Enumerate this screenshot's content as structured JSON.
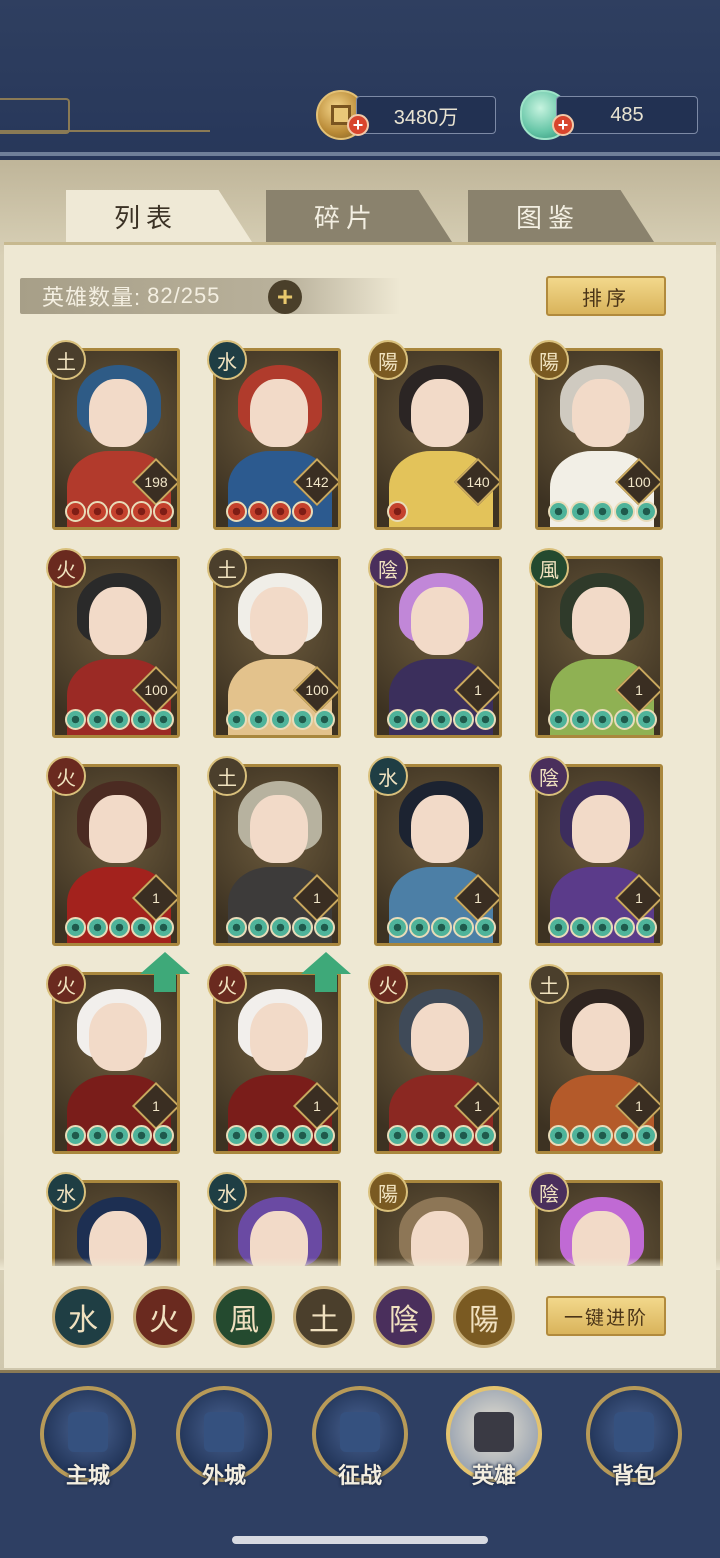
{
  "header": {
    "coin_value": "3480万",
    "gem_value": "485",
    "colors": {
      "bar": "#2b3a5a",
      "accent_gold": "#d9b45b"
    }
  },
  "tabs": [
    {
      "label": "列表",
      "active": true
    },
    {
      "label": "碎片",
      "active": false
    },
    {
      "label": "图鉴",
      "active": false
    }
  ],
  "hero_count": {
    "label": "英雄数量:",
    "value": "82/255"
  },
  "sort_label": "排序",
  "advance_label": "一键进阶",
  "heroes": [
    {
      "element": "土",
      "level": "198",
      "stars": 5,
      "star_color": "red",
      "hair": "#2e5b86",
      "outfit": "#b23a2c"
    },
    {
      "element": "水",
      "level": "142",
      "stars": 4,
      "star_color": "red",
      "hair": "#b03b2c",
      "outfit": "#2c5a8f"
    },
    {
      "element": "陽",
      "level": "140",
      "stars": 1,
      "star_color": "red",
      "hair": "#2b2524",
      "outfit": "#e3c35a"
    },
    {
      "element": "陽",
      "level": "100",
      "stars": 5,
      "star_color": "green",
      "hair": "#cfcac0",
      "outfit": "#f2efe6"
    },
    {
      "element": "火",
      "level": "100",
      "stars": 5,
      "star_color": "green",
      "hair": "#2a2a2a",
      "outfit": "#9b2a25"
    },
    {
      "element": "土",
      "level": "100",
      "stars": 5,
      "star_color": "green",
      "hair": "#f0eee8",
      "outfit": "#e3c28c"
    },
    {
      "element": "陰",
      "level": "1",
      "stars": 5,
      "star_color": "green",
      "hair": "#c187d8",
      "outfit": "#3b2f5c"
    },
    {
      "element": "風",
      "level": "1",
      "stars": 5,
      "star_color": "green",
      "hair": "#2f3a2a",
      "outfit": "#8fb153"
    },
    {
      "element": "火",
      "level": "1",
      "stars": 5,
      "star_color": "green",
      "hair": "#4b2b22",
      "outfit": "#a3221d"
    },
    {
      "element": "土",
      "level": "1",
      "stars": 5,
      "star_color": "green",
      "hair": "#b7b29f",
      "outfit": "#3d3b3a"
    },
    {
      "element": "水",
      "level": "1",
      "stars": 5,
      "star_color": "green",
      "hair": "#1c2331",
      "outfit": "#4c7fa6"
    },
    {
      "element": "陰",
      "level": "1",
      "stars": 5,
      "star_color": "green",
      "hair": "#3c2d5d",
      "outfit": "#5b3b8a"
    },
    {
      "element": "火",
      "level": "1",
      "stars": 5,
      "star_color": "green",
      "hair": "#f2efec",
      "outfit": "#7a1d1a",
      "upgrade": true
    },
    {
      "element": "火",
      "level": "1",
      "stars": 5,
      "star_color": "green",
      "hair": "#f2efec",
      "outfit": "#7a1d1a",
      "upgrade": true
    },
    {
      "element": "火",
      "level": "1",
      "stars": 5,
      "star_color": "green",
      "hair": "#3f4a58",
      "outfit": "#8b2822"
    },
    {
      "element": "土",
      "level": "1",
      "stars": 5,
      "star_color": "green",
      "hair": "#2f2520",
      "outfit": "#b45a2a"
    },
    {
      "element": "水",
      "level": "",
      "stars": 0,
      "star_color": "green",
      "hair": "#1d2f52",
      "outfit": "#4c6fb0"
    },
    {
      "element": "水",
      "level": "",
      "stars": 0,
      "star_color": "green",
      "hair": "#6a4aa3",
      "outfit": "#3a3860"
    },
    {
      "element": "陽",
      "level": "",
      "stars": 0,
      "star_color": "green",
      "hair": "#8d7656",
      "outfit": "#c9b89a"
    },
    {
      "element": "陰",
      "level": "",
      "stars": 0,
      "star_color": "green",
      "hair": "#c06ad4",
      "outfit": "#5b3b7a"
    }
  ],
  "element_filters": [
    {
      "glyph": "水",
      "color": "#1f3e44"
    },
    {
      "glyph": "火",
      "color": "#6a2a1f"
    },
    {
      "glyph": "風",
      "color": "#244a2f"
    },
    {
      "glyph": "土",
      "color": "#4b3f2c"
    },
    {
      "glyph": "陰",
      "color": "#4a2f5c"
    },
    {
      "glyph": "陽",
      "color": "#7a5a22"
    }
  ],
  "nav": [
    {
      "label": "主城",
      "active": false
    },
    {
      "label": "外城",
      "active": false
    },
    {
      "label": "征战",
      "active": false
    },
    {
      "label": "英雄",
      "active": true
    },
    {
      "label": "背包",
      "active": false
    }
  ]
}
